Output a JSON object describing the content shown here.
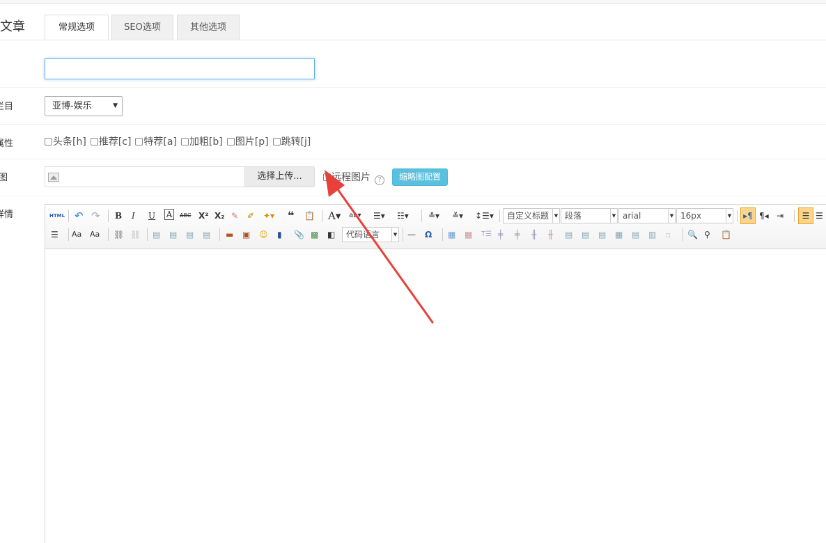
{
  "page": {
    "title": "文章"
  },
  "tabs": [
    {
      "label": "常规选项",
      "active": true
    },
    {
      "label": "SEO选项",
      "active": false
    },
    {
      "label": "其他选项",
      "active": false
    }
  ],
  "form": {
    "title_input": {
      "value": "",
      "placeholder": ""
    },
    "column": {
      "label": "栏目",
      "selected": "亚博-娱乐"
    },
    "attributes": {
      "label": "属性",
      "options": [
        {
          "label": "头条[h]",
          "checked": false
        },
        {
          "label": "推荐[c]",
          "checked": false
        },
        {
          "label": "特荐[a]",
          "checked": false
        },
        {
          "label": "加粗[b]",
          "checked": false
        },
        {
          "label": "图片[p]",
          "checked": false
        },
        {
          "label": "跳转[j]",
          "checked": false
        }
      ]
    },
    "thumbnail": {
      "label": "图",
      "upload_label": "选择上传...",
      "remote_label": "远程图片",
      "help_glyph": "?",
      "config_button": "缩略图配置"
    },
    "content": {
      "label": "详情"
    }
  },
  "editor": {
    "html_label": "HTML",
    "heading_combo": "自定义标题",
    "paragraph_combo": "段落",
    "font_combo": "arial",
    "size_combo": "16px",
    "code_combo": "代码语言"
  },
  "colors": {
    "accent": "#5bc0de",
    "annotation_arrow": "#e8403a"
  }
}
